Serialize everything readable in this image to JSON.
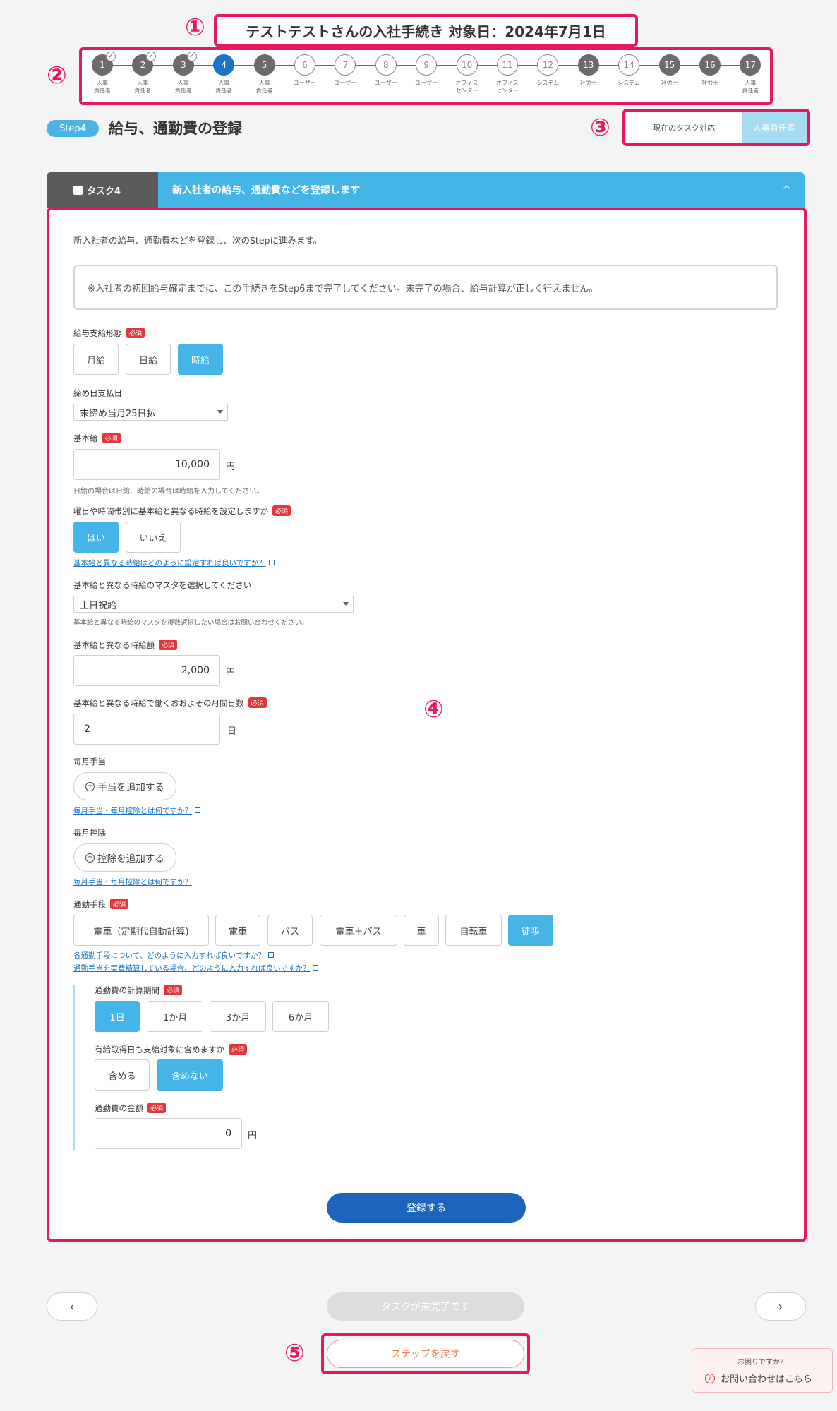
{
  "header": {
    "title": "テストテストさんの入社手続き 対象日：2024年7月1日"
  },
  "callouts": [
    "①",
    "②",
    "③",
    "④",
    "⑤"
  ],
  "stepper": {
    "steps": [
      {
        "num": "1",
        "label": "人事\n責任者",
        "state": "done"
      },
      {
        "num": "2",
        "label": "人事\n責任者",
        "state": "done"
      },
      {
        "num": "3",
        "label": "人事\n責任者",
        "state": "done"
      },
      {
        "num": "4",
        "label": "人事\n責任者",
        "state": "current"
      },
      {
        "num": "5",
        "label": "人事\n責任者",
        "state": "done-nocheck"
      },
      {
        "num": "6",
        "label": "ユーザー",
        "state": "todo"
      },
      {
        "num": "7",
        "label": "ユーザー",
        "state": "todo"
      },
      {
        "num": "8",
        "label": "ユーザー",
        "state": "todo"
      },
      {
        "num": "9",
        "label": "ユーザー",
        "state": "todo"
      },
      {
        "num": "10",
        "label": "オフィス\nセンター",
        "state": "todo"
      },
      {
        "num": "11",
        "label": "オフィス\nセンター",
        "state": "todo"
      },
      {
        "num": "12",
        "label": "システム",
        "state": "todo"
      },
      {
        "num": "13",
        "label": "社労士",
        "state": "done-nocheck"
      },
      {
        "num": "14",
        "label": "システム",
        "state": "todo"
      },
      {
        "num": "15",
        "label": "社労士",
        "state": "done-nocheck"
      },
      {
        "num": "16",
        "label": "社労士",
        "state": "done-nocheck"
      },
      {
        "num": "17",
        "label": "人事\n責任者",
        "state": "done-nocheck"
      }
    ],
    "check_mark": "✓"
  },
  "step_header": {
    "badge": "Step4",
    "title": "給与、通勤費の登録",
    "task_owner_label": "現在のタスク対応",
    "task_owner_value": "人事責任者"
  },
  "task": {
    "tag": "タスク4",
    "description": "新入社者の給与、通勤費などを登録します",
    "collapse_icon": "^"
  },
  "form": {
    "intro": "新入社者の給与、通勤費などを登録し、次のStepに進みます。",
    "notice": "※入社者の初回給与確定までに、この手続きをStep6まで完了してください。未完了の場合、給与計算が正しく行えません。",
    "required_badge": "必須",
    "pay_type": {
      "label": "給与支給形態",
      "options": [
        "月給",
        "日給",
        "時給"
      ],
      "selected": "時給"
    },
    "closing": {
      "label": "締め日支払日",
      "value": "末締め当月25日払"
    },
    "base_pay": {
      "label": "基本給",
      "value": "10,000",
      "unit": "円",
      "hint": "日給の場合は日給、時給の場合は時給を入力してください。"
    },
    "diff_rate": {
      "label": "曜日や時間帯別に基本給と異なる時給を設定しますか",
      "options": [
        "はい",
        "いいえ"
      ],
      "selected": "はい",
      "link": "基本給と異なる時給はどのように設定すれば良いですか？"
    },
    "master": {
      "label": "基本給と異なる時給のマスタを選択してください",
      "value": "土日祝給",
      "hint": "基本給と異なる時給のマスタを複数選択したい場合はお問い合わせください。"
    },
    "diff_amount": {
      "label": "基本給と異なる時給額",
      "value": "2,000",
      "unit": "円"
    },
    "diff_days": {
      "label": "基本給と異なる時給で働くおおよその月間日数",
      "value": "2",
      "unit": "日"
    },
    "allowance": {
      "label": "毎月手当",
      "button": "手当を追加する",
      "link": "毎月手当・毎月控除とは何ですか？"
    },
    "deduction": {
      "label": "毎月控除",
      "button": "控除を追加する",
      "link": "毎月手当・毎月控除とは何ですか？"
    },
    "commute": {
      "label": "通勤手段",
      "options": [
        "電車（定期代自動計算)",
        "電車",
        "バス",
        "電車＋バス",
        "車",
        "自転車",
        "徒歩"
      ],
      "selected": "徒歩",
      "link1": "各通勤手段について、どのように入力すれば良いですか？",
      "link2": "通勤手当を実費精算している場合、どのように入力すれば良いですか？"
    },
    "period": {
      "label": "通勤費の計算期間",
      "options": [
        "1日",
        "1か月",
        "3か月",
        "6か月"
      ],
      "selected": "1日"
    },
    "paid_leave": {
      "label": "有給取得日も支給対象に含めますか",
      "options": [
        "含める",
        "含めない"
      ],
      "selected": "含めない"
    },
    "commute_amount": {
      "label": "通勤費の金額",
      "value": "0",
      "unit": "円"
    },
    "submit": "登録する"
  },
  "footer": {
    "prev_icon": "‹",
    "next_icon": "›",
    "incomplete": "タスクが未完了です",
    "revert": "ステップを戻す"
  },
  "help": {
    "question": "お困りですか？",
    "contact": "お問い合わせはこちら",
    "icon": "?"
  },
  "colors": {
    "accent": "#45b4e6",
    "primary": "#1d64bd",
    "callout": "#e6185e",
    "required": "#e2373c"
  }
}
